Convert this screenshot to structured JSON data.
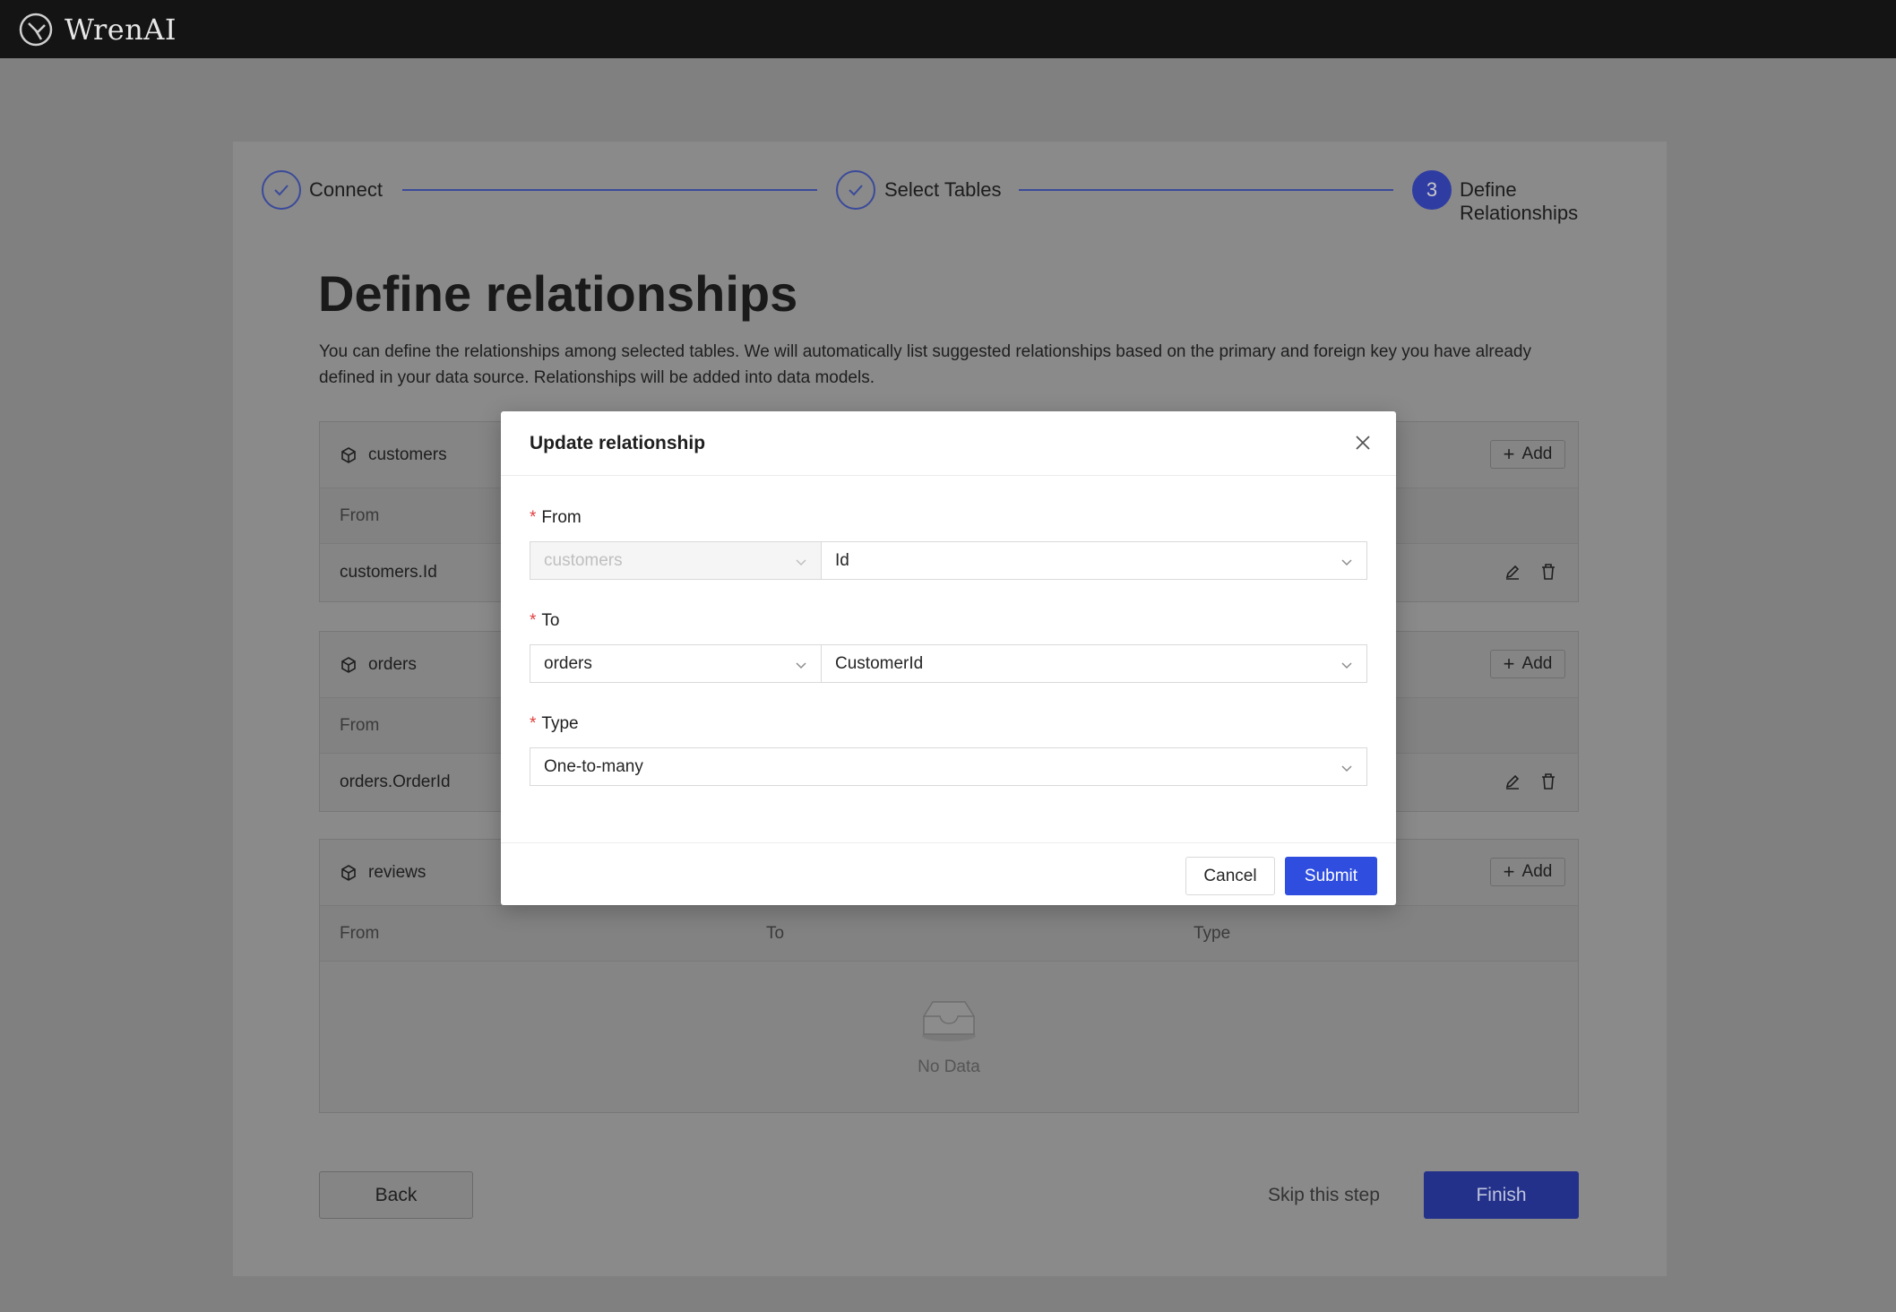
{
  "app": {
    "name": "WrenAI"
  },
  "steps": [
    {
      "label": "Connect",
      "state": "done"
    },
    {
      "label": "Select Tables",
      "state": "done"
    },
    {
      "label": "Define Relationships",
      "state": "active",
      "number": "3"
    }
  ],
  "page": {
    "title": "Define relationships",
    "description": "You can define the relationships among selected tables. We will automatically list suggested relationships based on the primary and foreign key you have already defined in your data source. Relationships will be added into data models."
  },
  "panels": [
    {
      "name": "customers",
      "add_label": "Add",
      "col_from": "From",
      "rows": [
        {
          "from": "customers.Id"
        }
      ]
    },
    {
      "name": "orders",
      "add_label": "Add",
      "col_from": "From",
      "rows": [
        {
          "from": "orders.OrderId"
        }
      ]
    },
    {
      "name": "reviews",
      "add_label": "Add",
      "col_from": "From",
      "col_to": "To",
      "col_type": "Type",
      "empty_text": "No Data"
    }
  ],
  "footer": {
    "back_label": "Back",
    "skip_label": "Skip this step",
    "finish_label": "Finish"
  },
  "modal": {
    "title": "Update relationship",
    "from": {
      "label": "From",
      "model": "customers",
      "field": "Id"
    },
    "to": {
      "label": "To",
      "model": "orders",
      "field": "CustomerId"
    },
    "type": {
      "label": "Type",
      "value": "One-to-many"
    },
    "cancel_label": "Cancel",
    "submit_label": "Submit"
  },
  "colors": {
    "primary": "#2f4ee0",
    "required": "#e04040",
    "topbar": "#141414"
  },
  "icons": [
    "logo-icon",
    "check-icon",
    "cube-icon",
    "plus-icon",
    "edit-icon",
    "delete-icon",
    "close-icon",
    "chevron-down-icon",
    "empty-inbox-icon"
  ]
}
